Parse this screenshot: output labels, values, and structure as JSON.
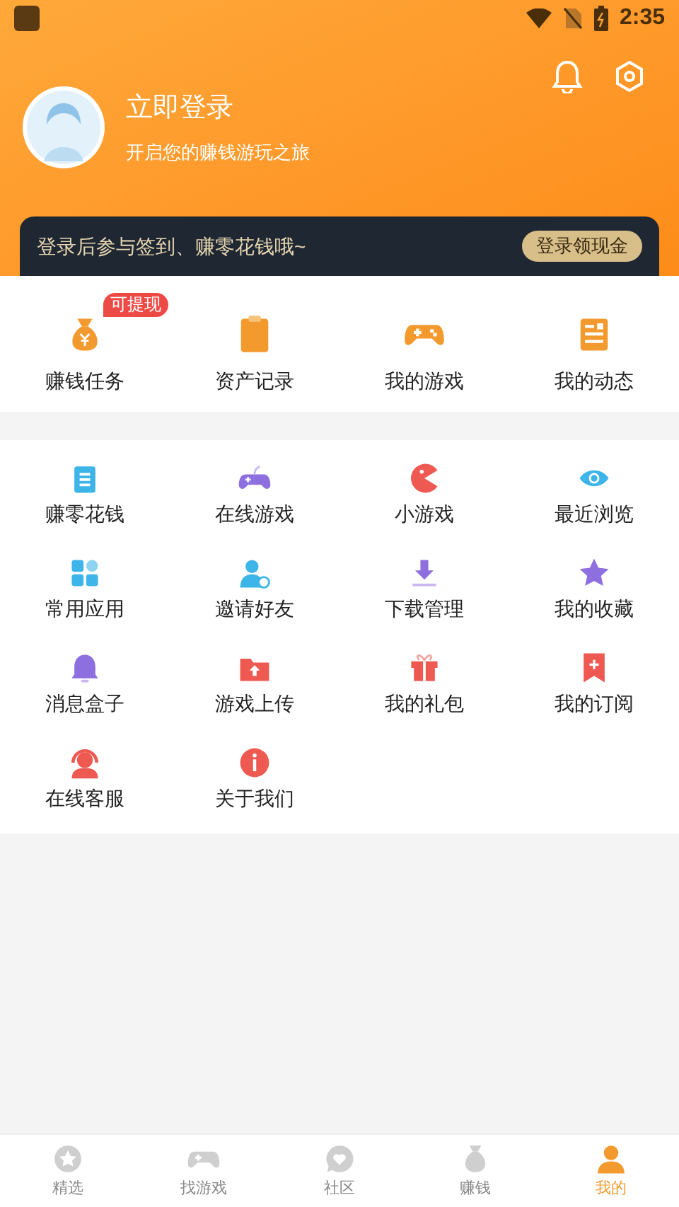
{
  "status_bar": {
    "time": "2:35"
  },
  "profile": {
    "title": "立即登录",
    "subtitle": "开启您的赚钱游玩之旅"
  },
  "banner": {
    "text": "登录后参与签到、赚零花钱哦~",
    "button": "登录领现金"
  },
  "quick_actions": [
    {
      "label": "赚钱任务",
      "badge": "可提现"
    },
    {
      "label": "资产记录"
    },
    {
      "label": "我的游戏"
    },
    {
      "label": "我的动态"
    }
  ],
  "services": [
    {
      "label": "赚零花钱"
    },
    {
      "label": "在线游戏"
    },
    {
      "label": "小游戏"
    },
    {
      "label": "最近浏览"
    },
    {
      "label": "常用应用"
    },
    {
      "label": "邀请好友"
    },
    {
      "label": "下载管理"
    },
    {
      "label": "我的收藏"
    },
    {
      "label": "消息盒子"
    },
    {
      "label": "游戏上传"
    },
    {
      "label": "我的礼包"
    },
    {
      "label": "我的订阅"
    },
    {
      "label": "在线客服"
    },
    {
      "label": "关于我们"
    }
  ],
  "bottom_nav": [
    {
      "label": "精选",
      "selected": false
    },
    {
      "label": "找游戏",
      "selected": false
    },
    {
      "label": "社区",
      "selected": false
    },
    {
      "label": "赚钱",
      "selected": false
    },
    {
      "label": "我的",
      "selected": true
    }
  ]
}
